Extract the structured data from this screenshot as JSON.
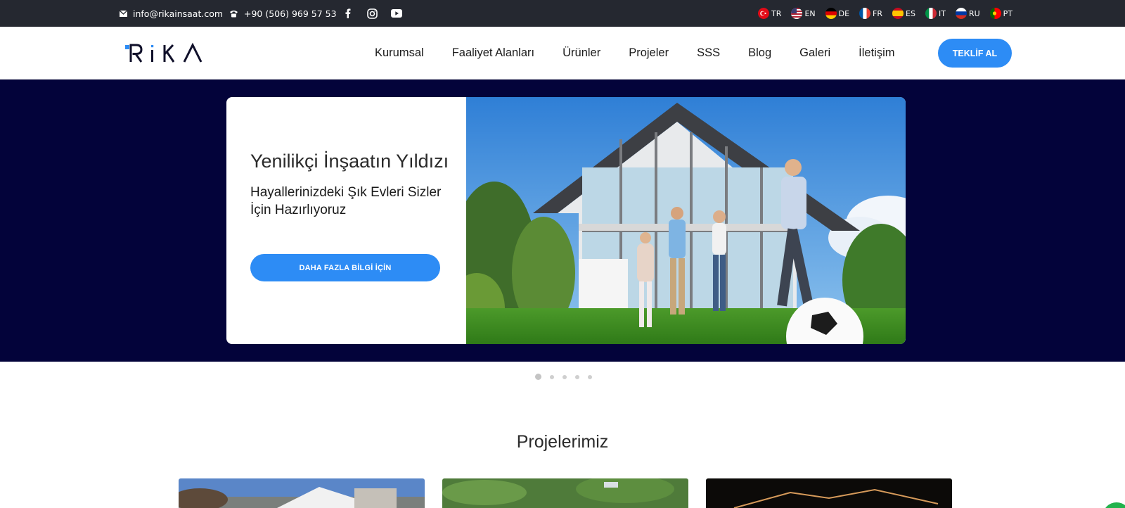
{
  "topbar": {
    "email": "info@rikainsaat.com",
    "phone": "+90 (506) 969 57 53",
    "languages": [
      {
        "code": "TR"
      },
      {
        "code": "EN"
      },
      {
        "code": "DE"
      },
      {
        "code": "FR"
      },
      {
        "code": "ES"
      },
      {
        "code": "IT"
      },
      {
        "code": "RU"
      },
      {
        "code": "PT"
      }
    ]
  },
  "header": {
    "nav": [
      "Kurumsal",
      "Faaliyet Alanları",
      "Ürünler",
      "Projeler",
      "SSS",
      "Blog",
      "Galeri",
      "İletişim"
    ],
    "cta_label": "TEKLİF AL"
  },
  "hero": {
    "title": "Yenilikçi İnşaatın Yıldızı",
    "subtitle": "Hayallerinizdeki Şık Evleri Sizler İçin Hazırlıyoruz",
    "button_label": "DAHA FAZLA BİLGİ İÇİN",
    "slides_count": 5,
    "active_slide": 1
  },
  "section": {
    "title": "Projelerimiz"
  },
  "colors": {
    "topbar": "#252830",
    "hero_bg": "#03033a",
    "accent": "#2d8cf5"
  }
}
